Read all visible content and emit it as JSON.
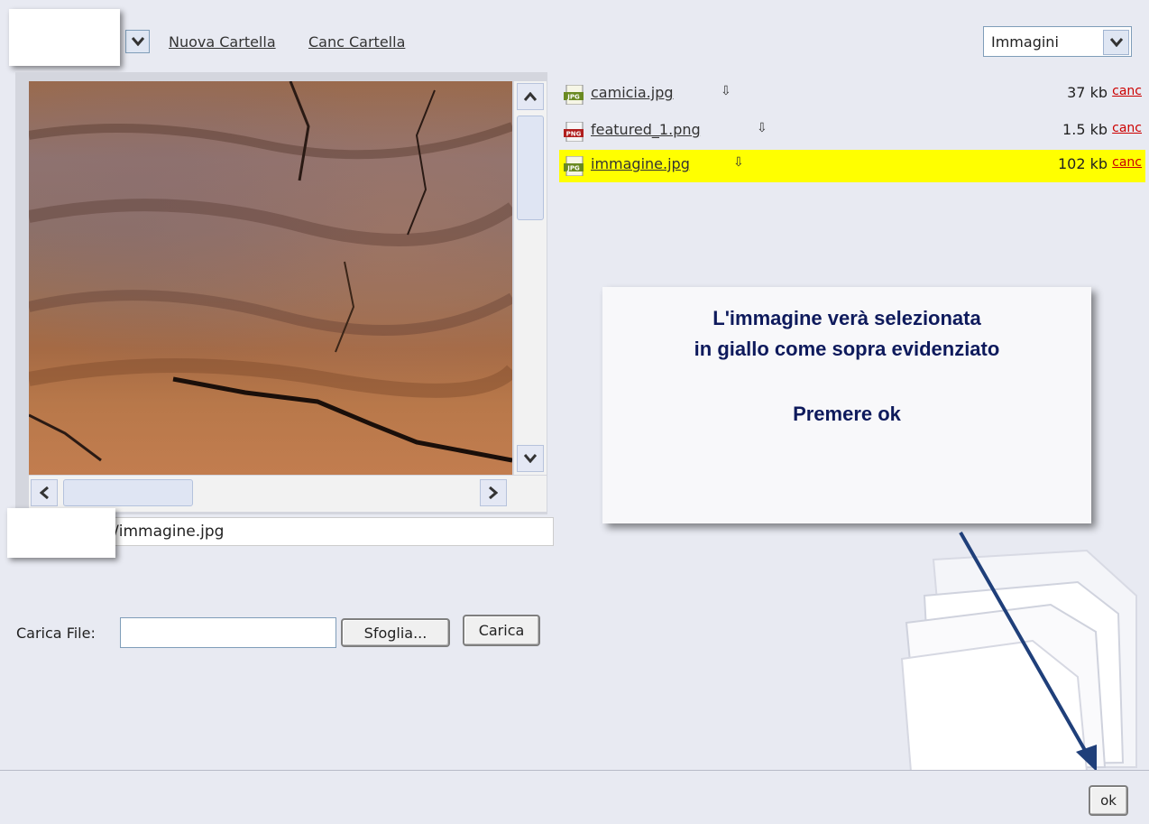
{
  "toolbar": {
    "new_folder_label": "Nuova Cartella",
    "delete_folder_label": "Canc Cartella",
    "filter_value": "Immagini"
  },
  "files": [
    {
      "name": "camicia.jpg",
      "type": "JPG",
      "size": "37 kb",
      "delete_label": "canc",
      "selected": false
    },
    {
      "name": "featured_1.png",
      "type": "PNG",
      "size": "1.5 kb",
      "delete_label": "canc",
      "selected": false
    },
    {
      "name": "immagine.jpg",
      "type": "JPG",
      "size": "102 kb",
      "delete_label": "canc",
      "selected": true
    }
  ],
  "preview": {
    "path_value": "/immagine.jpg"
  },
  "upload": {
    "label": "Carica File:",
    "input_value": "",
    "browse_label": "Sfoglia...",
    "upload_label": "Carica"
  },
  "callout": {
    "line1": "L'immagine verà selezionata",
    "line2": "in giallo come sopra evidenziato",
    "line3": "Premere ok"
  },
  "footer": {
    "ok_label": "ok"
  },
  "colors": {
    "selection": "#ffff00",
    "callout_text": "#0e1a5c",
    "arrow": "#1f3f7a",
    "delete_link": "#cc0000"
  }
}
